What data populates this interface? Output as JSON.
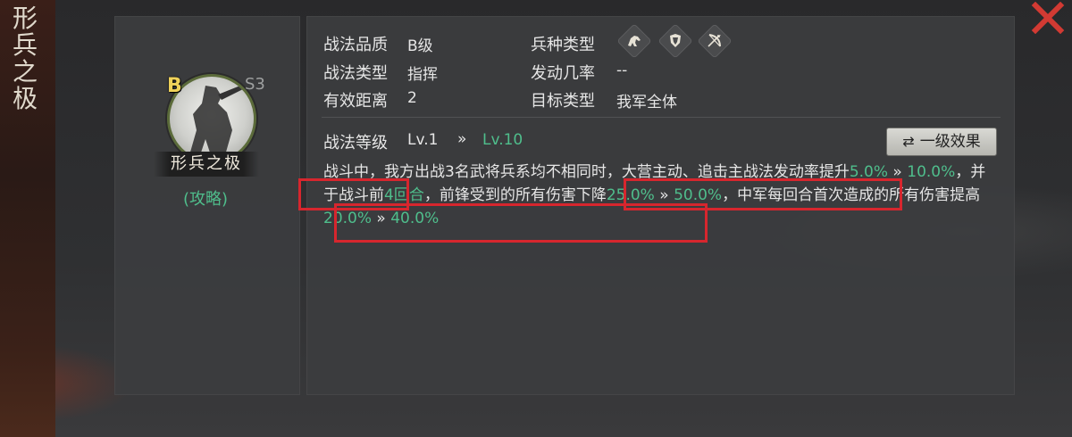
{
  "window": {
    "vertical_title": [
      "形",
      "兵",
      "之",
      "极"
    ],
    "close_icon": "close-icon"
  },
  "skill_card": {
    "grade": "B",
    "season": "S3",
    "name": "形兵之极",
    "strategy_link": "(攻略)"
  },
  "attributes": {
    "quality_label": "战法品质",
    "quality_value": "B级",
    "type_label": "战法类型",
    "type_value": "指挥",
    "range_label": "有效距离",
    "range_value": "2",
    "troop_label": "兵种类型",
    "troop_icons": [
      "cavalry-icon",
      "shield-icon",
      "bow-icon"
    ],
    "trigger_label": "发动几率",
    "trigger_value": "--",
    "target_label": "目标类型",
    "target_value": "我军全体"
  },
  "level": {
    "label": "战法等级",
    "from": "Lv.1",
    "arrow": "»",
    "to": "Lv.10",
    "effect_button": "一级效果"
  },
  "description": {
    "p1": "战斗中，我方出战3名武将兵系均不相同时，大营主动、追击主战法发动率提升",
    "v1": "5.0%",
    "a1": " » ",
    "v2": "10.0%",
    "p2": "，并于战斗前",
    "v3": "4回合",
    "p3": "，前锋受到的所有伤害下降",
    "v4": "25.0%",
    "a2": " » ",
    "v5": "50.0%",
    "p4": "，中军每回合首次造成的所有伤害提高",
    "v6": "20.0%",
    "a3": " » ",
    "v7": "40.0%"
  },
  "colors": {
    "accent_green": "#4fbe8c",
    "highlight_red": "#d7262e",
    "grade_gold": "#f0d25a"
  }
}
